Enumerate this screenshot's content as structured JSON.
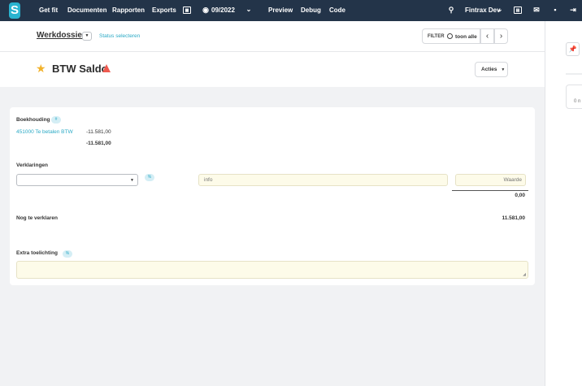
{
  "nav": {
    "logo": "S",
    "items": [
      "Get fit",
      "Documenten",
      "Rapporten",
      "Exports"
    ],
    "period": "09/2022",
    "right_items": [
      "Preview",
      "Debug",
      "Code"
    ],
    "user": "Fintrax Dev"
  },
  "subheader": {
    "werkdossier": "Werkdossier",
    "status_link": "Status selecteren",
    "filter_label": "FILTER",
    "filter_value": "toon alle"
  },
  "title": {
    "text": "BTW Saldo",
    "actions_label": "Acties"
  },
  "card": {
    "boekhouding_label": "Boekhouding",
    "boekhouding_tag": "#",
    "account_link": "451000 Te betalen BTW",
    "account_amount": "-11.581,00",
    "account_total": "-11.581,00",
    "verklaringen_label": "Verklaringen",
    "verklaringen_tag": "%",
    "info_placeholder": "info",
    "waarde_placeholder": "Waarde",
    "verklaringen_total": "0,00",
    "nog_label": "Nog te verklaren",
    "nog_value": "11.581,00",
    "extra_label": "Extra toelichting",
    "extra_tag": "%"
  },
  "rightpanel": {
    "partial_text": "0 n"
  },
  "colors": {
    "nav_bg": "#233449",
    "accent": "#2aa9c5",
    "star": "#f2b22b",
    "warning": "#ee5a50",
    "input_bg": "#fdfbe9"
  }
}
